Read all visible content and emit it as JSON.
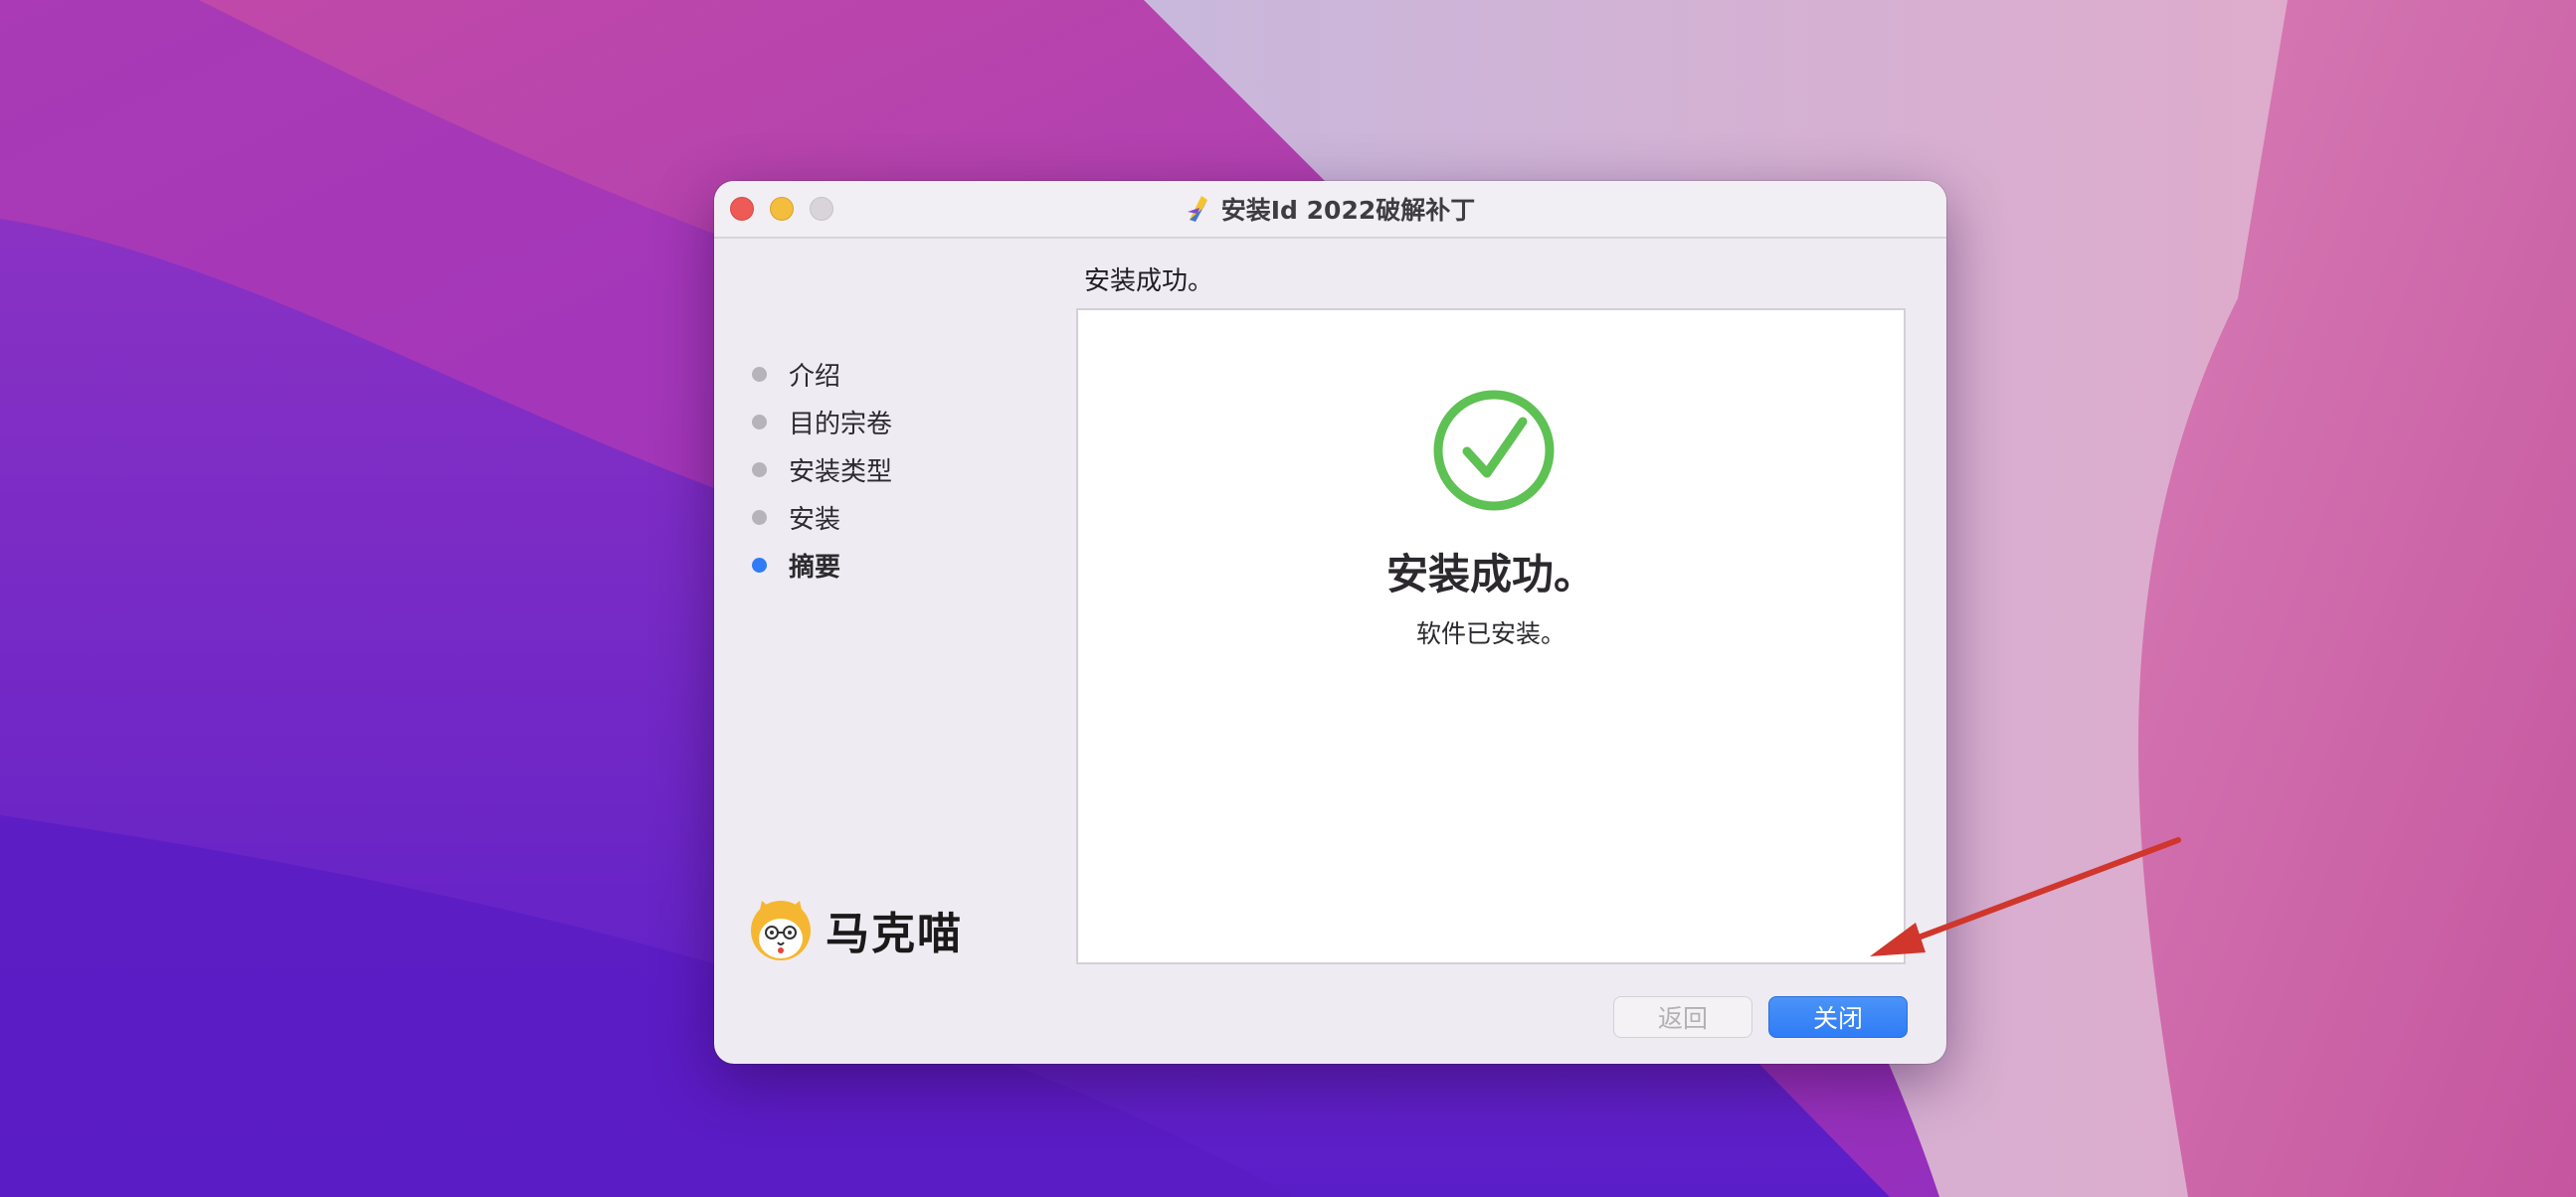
{
  "window": {
    "title": "安装Id 2022破解补丁"
  },
  "sidebar": {
    "steps": [
      {
        "label": "介绍",
        "active": false
      },
      {
        "label": "目的宗卷",
        "active": false
      },
      {
        "label": "安装类型",
        "active": false
      },
      {
        "label": "安装",
        "active": false
      },
      {
        "label": "摘要",
        "active": true
      }
    ],
    "logo_text": "马克喵"
  },
  "main": {
    "heading": "安装成功。",
    "success_title": "安装成功。",
    "success_subtitle": "软件已安装。"
  },
  "buttons": {
    "back_label": "返回",
    "close_label": "关闭"
  },
  "colors": {
    "accent": "#2f7cf6",
    "success": "#5ec153",
    "annotation_arrow": "#d0362c"
  }
}
